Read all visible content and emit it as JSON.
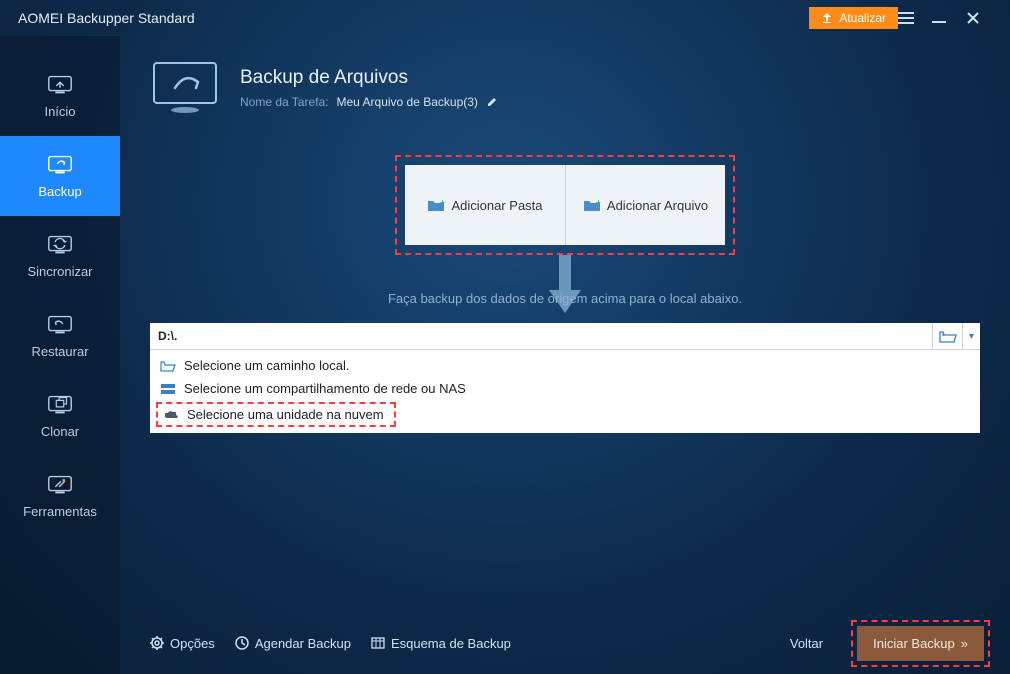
{
  "titlebar": {
    "app_name": "AOMEI Backupper Standard",
    "upgrade_label": "Atualizar"
  },
  "sidebar": {
    "items": [
      {
        "label": "Início"
      },
      {
        "label": "Backup"
      },
      {
        "label": "Sincronizar"
      },
      {
        "label": "Restaurar"
      },
      {
        "label": "Clonar"
      },
      {
        "label": "Ferramentas"
      }
    ]
  },
  "header": {
    "title": "Backup de Arquivos",
    "task_label": "Nome da Tarefa:",
    "task_name": "Meu Arquivo de Backup(3)"
  },
  "source": {
    "add_folder": "Adicionar Pasta",
    "add_file": "Adicionar Arquivo",
    "hint": "Faça backup dos dados de origem acima para o local abaixo."
  },
  "destination": {
    "path": "D:\\.",
    "options": [
      "Selecione um caminho local.",
      "Selecione um compartilhamento de rede ou NAS",
      "Selecione uma unidade na nuvem"
    ]
  },
  "footer": {
    "options": "Opções",
    "schedule": "Agendar Backup",
    "scheme": "Esquema de Backup",
    "back": "Voltar",
    "start": "Iniciar Backup"
  }
}
